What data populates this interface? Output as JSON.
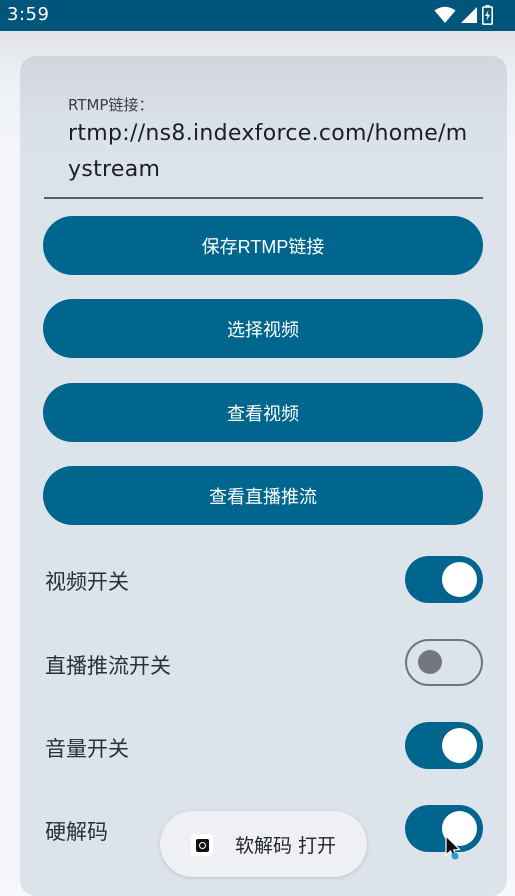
{
  "status_bar": {
    "time": "3:59",
    "icons": [
      "wifi-icon",
      "signal-icon",
      "battery-charging-icon"
    ]
  },
  "rtmp": {
    "label": "RTMP链接：",
    "value": "rtmp://ns8.indexforce.com/home/mystream"
  },
  "buttons": {
    "save_rtmp": "保存RTMP链接",
    "select_video": "选择视频",
    "view_video": "查看视频",
    "view_live_push": "查看直播推流"
  },
  "switches": [
    {
      "label": "视频开关",
      "on": true
    },
    {
      "label": "直播推流开关",
      "on": false
    },
    {
      "label": "音量开关",
      "on": true
    },
    {
      "label": "硬解码",
      "on": true
    }
  ],
  "toast": {
    "text": "软解码 打开"
  },
  "colors": {
    "status_bar": "#00567a",
    "accent": "#00668e",
    "card": "#dde3eb"
  }
}
